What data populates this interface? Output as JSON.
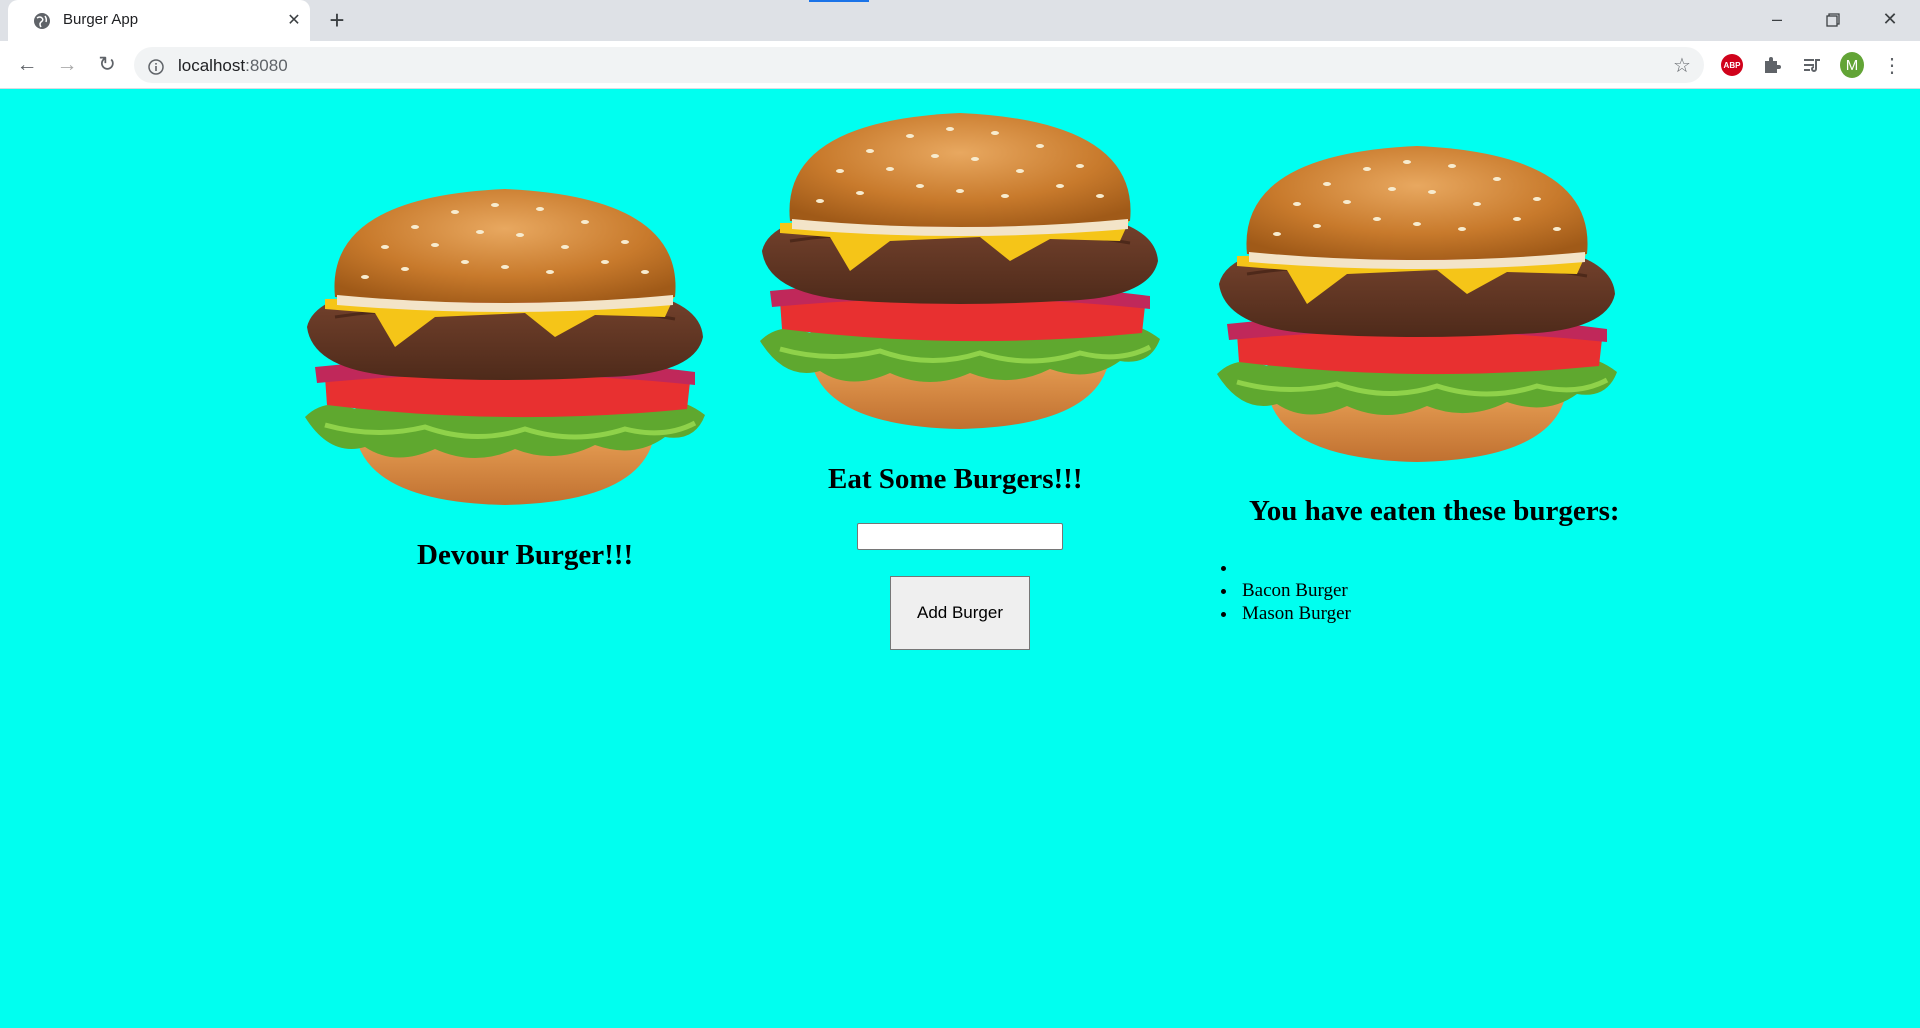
{
  "browser": {
    "tab_title": "Burger App",
    "url_host": "localhost",
    "url_port": ":8080",
    "profile_initial": "M",
    "adblock_label": "ABP",
    "icons": {
      "tab_favicon": "globe-icon",
      "tab_close": "close-icon",
      "new_tab": "plus-icon",
      "minimize": "minimize-icon",
      "restore": "restore-icon",
      "close": "close-window-icon",
      "back": "back-arrow-icon",
      "forward": "forward-arrow-icon",
      "reload": "reload-icon",
      "info": "info-icon",
      "bookmark": "star-icon",
      "extensions": "puzzle-icon",
      "media": "media-queue-icon",
      "menu": "kebab-menu-icon"
    }
  },
  "page": {
    "background_color": "#00fff0",
    "devour": {
      "heading": "Devour Burger!!!",
      "image": "burger-image"
    },
    "add": {
      "heading": "Eat Some Burgers!!!",
      "input_value": "",
      "button_label": "Add Burger",
      "image": "burger-image"
    },
    "eaten": {
      "heading": "You have eaten these burgers:",
      "items": [
        "",
        "Bacon Burger",
        "Mason Burger"
      ],
      "image": "burger-image"
    }
  }
}
